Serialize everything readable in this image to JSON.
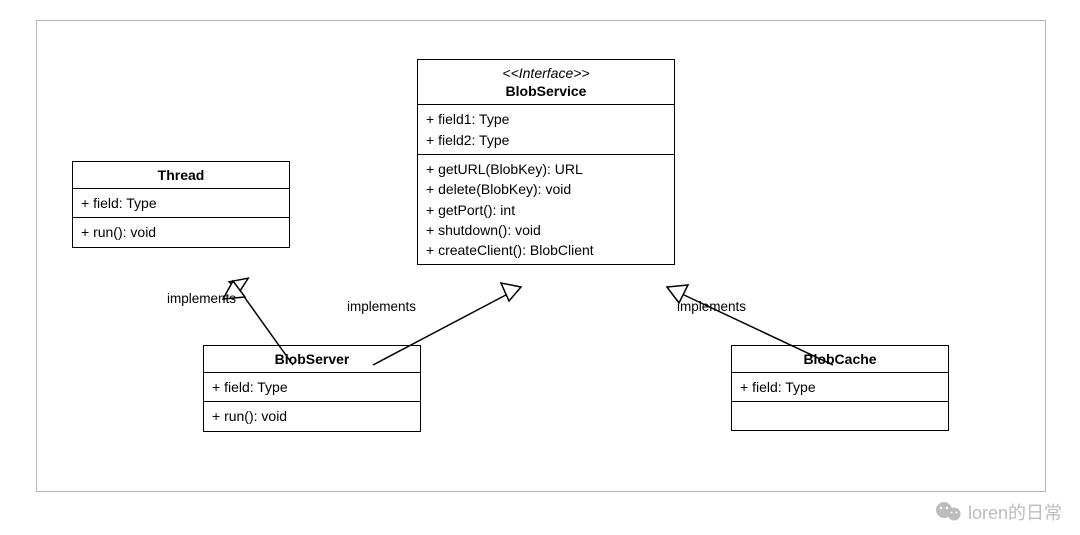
{
  "classes": {
    "thread": {
      "title": "Thread",
      "fields": [
        "+ field: Type"
      ],
      "methods": [
        "+ run(): void"
      ]
    },
    "blobService": {
      "stereotype": "<<Interface>>",
      "title": "BlobService",
      "fields": [
        "+ field1: Type",
        "+ field2: Type"
      ],
      "methods": [
        "+ getURL(BlobKey): URL",
        "+ delete(BlobKey): void",
        "+ getPort(): int",
        "+ shutdown(): void",
        "+ createClient(): BlobClient"
      ]
    },
    "blobServer": {
      "title": "BlobServer",
      "fields": [
        "+ field: Type"
      ],
      "methods": [
        "+ run(): void"
      ]
    },
    "blobCache": {
      "title": "BlobCache",
      "fields": [
        "+ field: Type"
      ]
    }
  },
  "relations": {
    "implements1": "implements",
    "implements2": "implements",
    "implements3": "implements"
  },
  "watermark": "loren的日常"
}
